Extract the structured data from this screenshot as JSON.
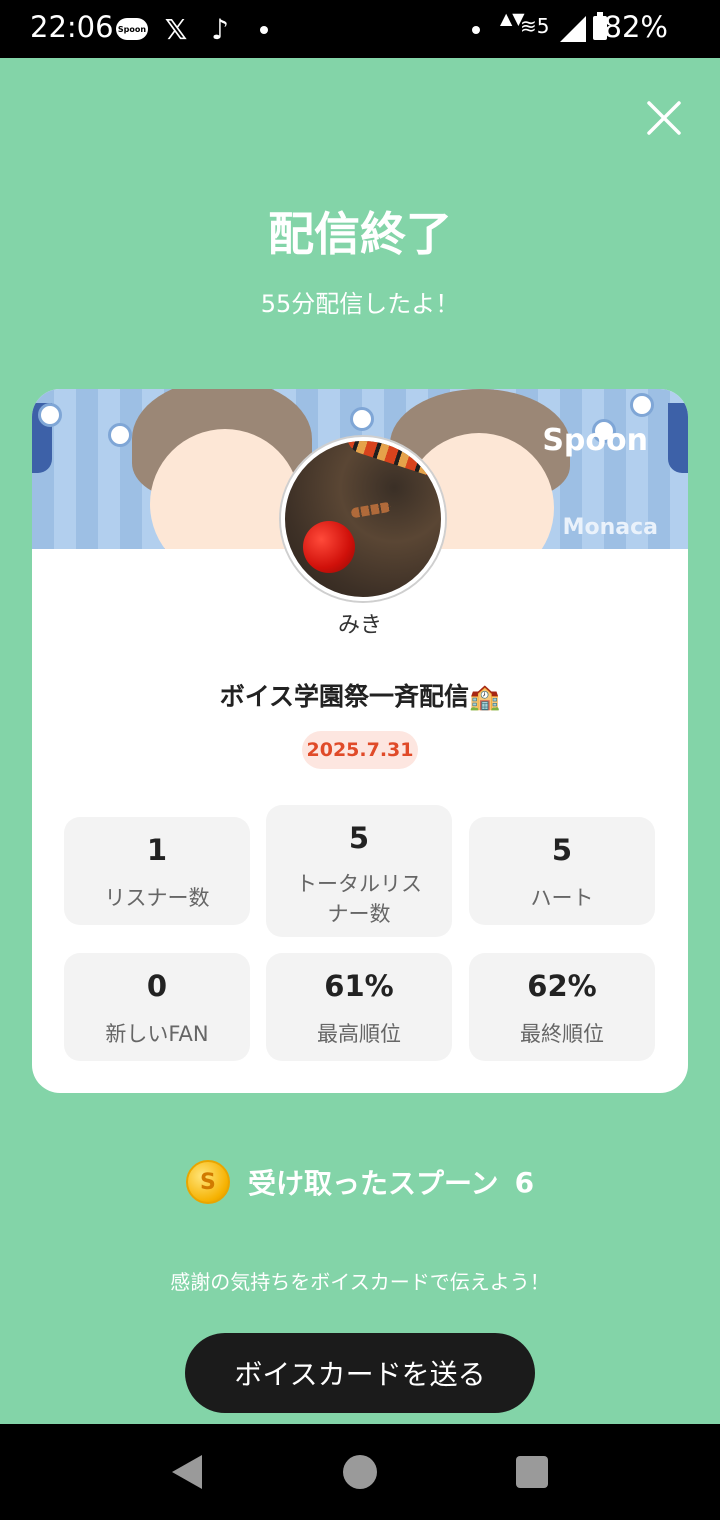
{
  "status_bar": {
    "time": "22:06",
    "battery": "82%",
    "apps": [
      "spoon-icon",
      "x-icon",
      "tiktok-icon"
    ],
    "spoon_label": "Spoon",
    "x_glyph": "𝕏",
    "tiktok_glyph": "♪",
    "wifi_glyph": "≋5",
    "arrows_glyph": "▲▼"
  },
  "header": {
    "title": "配信終了",
    "subtitle": "55分配信したよ！"
  },
  "card": {
    "banner": {
      "logo": "Spoon",
      "team": "Monaca"
    },
    "username": "みき",
    "broadcast_title": "ボイス学園祭一斉配信🏫",
    "date": "2025.7.31",
    "stats": [
      {
        "value": "1",
        "label": "リスナー数"
      },
      {
        "value": "5",
        "label": "トータルリスナー数"
      },
      {
        "value": "5",
        "label": "ハート"
      },
      {
        "value": "0",
        "label": "新しいFAN"
      },
      {
        "value": "61%",
        "label": "最高順位"
      },
      {
        "value": "62%",
        "label": "最終順位"
      }
    ]
  },
  "spoons": {
    "coin_letter": "S",
    "label": "受け取ったスプーン",
    "count": "6"
  },
  "footer": {
    "thanks": "感謝の気持ちをボイスカードで伝えよう！",
    "button": "ボイスカードを送る"
  },
  "colors": {
    "background": "#83d4a8",
    "date_badge_text": "#e04a28",
    "button_bg": "#1b1b1b"
  }
}
